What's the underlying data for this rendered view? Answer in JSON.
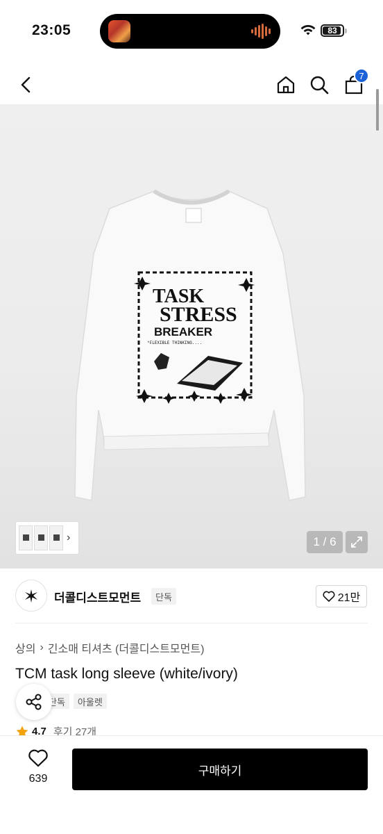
{
  "status_bar": {
    "time": "23:05",
    "battery": "83"
  },
  "nav": {
    "back_icon": "chevron-left-icon",
    "home_icon": "home-icon",
    "search_icon": "search-icon",
    "cart_icon": "shopping-bag-icon",
    "cart_count": "7"
  },
  "hero": {
    "page_indicator": "1 / 6",
    "print_text": {
      "line1": "TASK",
      "line2": "STRESS",
      "line3": "BREAKER",
      "line4": "*FLEXIBLE THINKING...."
    }
  },
  "brand": {
    "name": "더콜디스트모먼트",
    "tag": "단독",
    "like_count": "21만"
  },
  "product": {
    "breadcrumb": [
      "상의",
      "긴소매 티셔츠 (더콜디스트모먼트)"
    ],
    "title": "TCM task long sleeve (white/ivory)",
    "tags": [
      "단독",
      "아울렛"
    ],
    "rating": "4.7",
    "reviews": "후기 27개"
  },
  "bottom_bar": {
    "wish_count": "639",
    "buy_label": "구매하기"
  },
  "colors": {
    "accent_badge": "#1b62d8",
    "star": "#f2a20c",
    "buy_button": "#000000"
  }
}
